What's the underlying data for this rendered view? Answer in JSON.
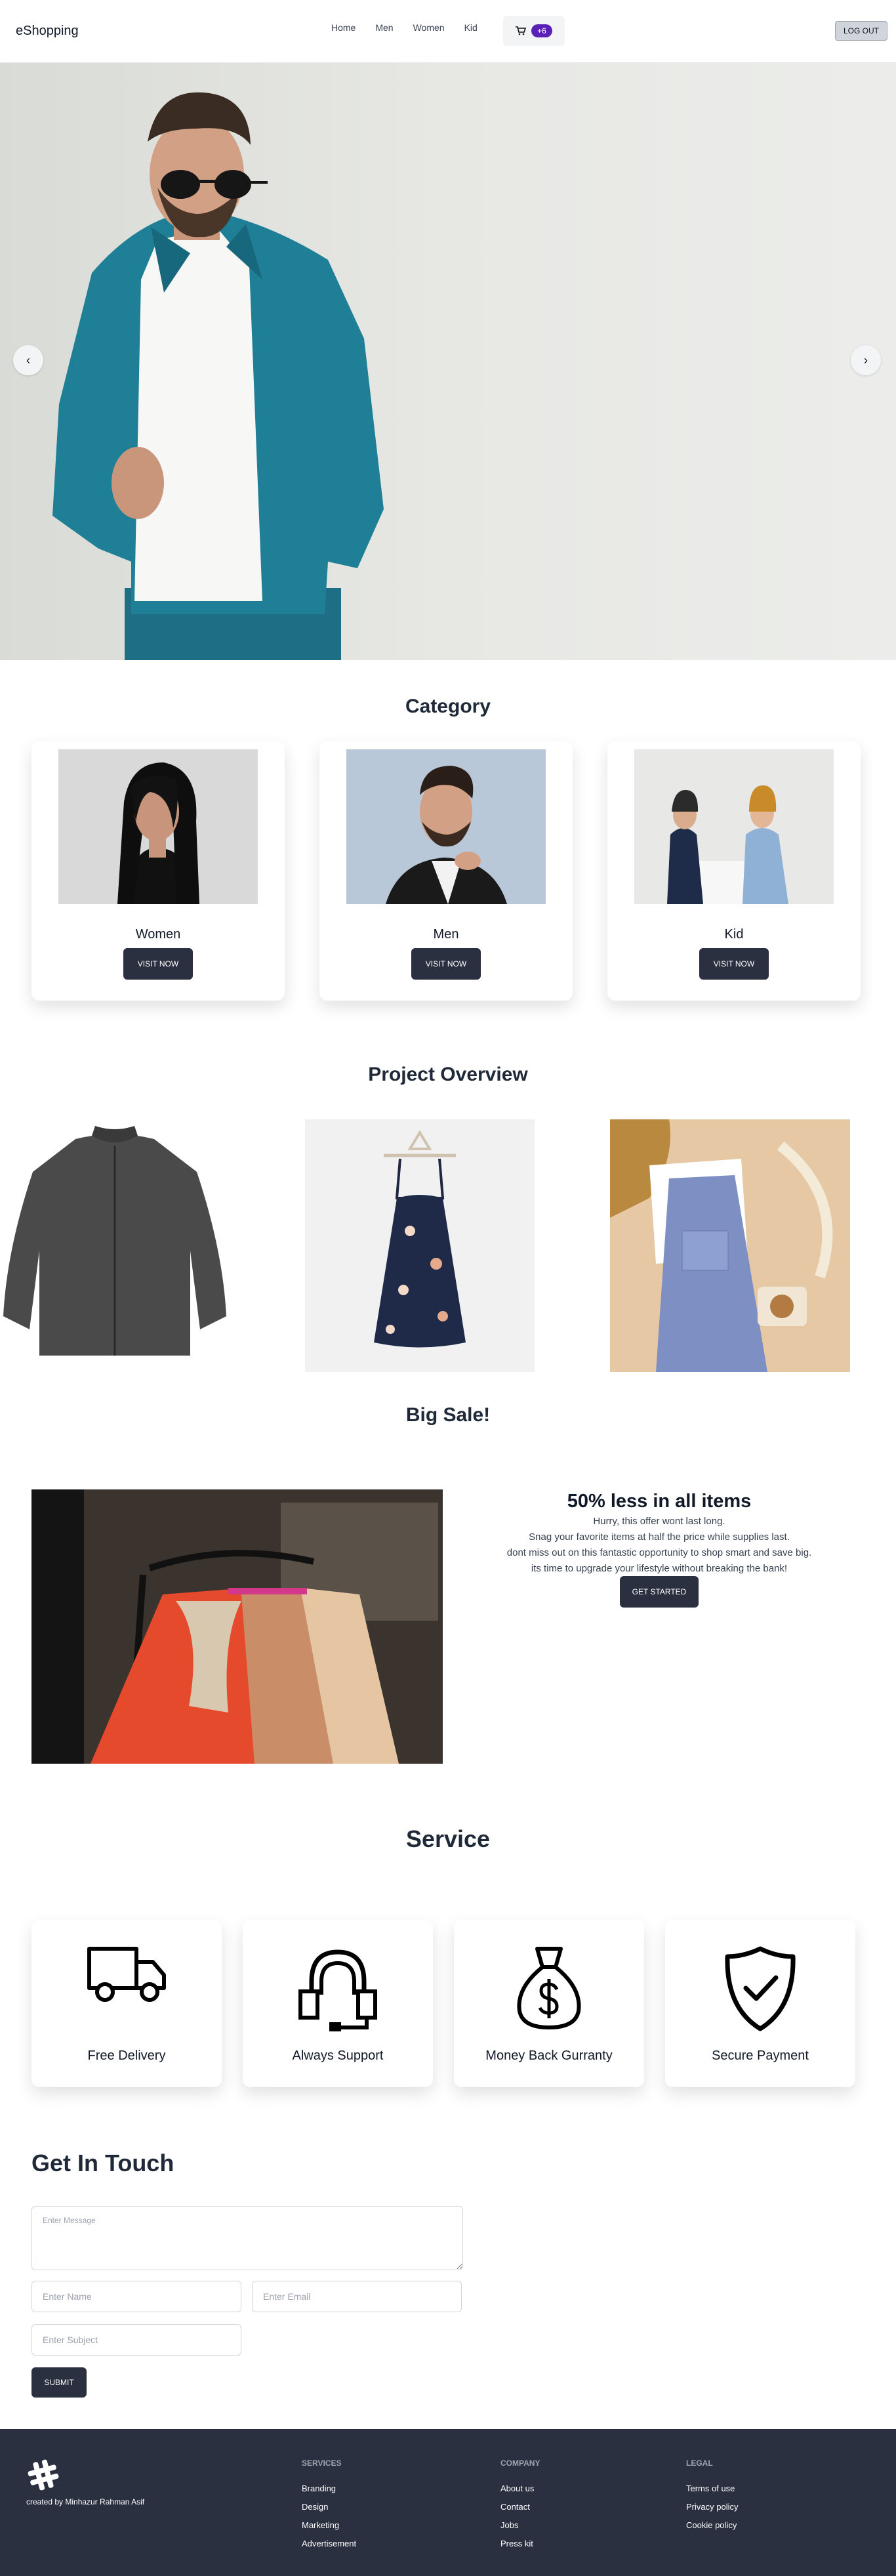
{
  "navbar": {
    "brand": "eShopping",
    "links": [
      "Home",
      "Men",
      "Women",
      "Kid"
    ],
    "cart_count": "+6",
    "logout_label": "LOG OUT"
  },
  "hero": {
    "prev": "‹",
    "next": "›"
  },
  "category": {
    "title": "Category",
    "cards": [
      {
        "name": "Women",
        "button": "VISIT NOW"
      },
      {
        "name": "Men",
        "button": "VISIT NOW"
      },
      {
        "name": "Kid",
        "button": "VISIT NOW"
      }
    ]
  },
  "overview": {
    "title": "Project Overview"
  },
  "sale": {
    "title": "Big Sale!",
    "heading": "50% less in all items",
    "lines": [
      "Hurry, this offer wont last long.",
      "Snag your favorite items at half the price while supplies last.",
      "dont miss out on this fantastic opportunity to shop smart and save big.",
      "its time to upgrade your lifestyle without breaking the bank!"
    ],
    "button": "GET STARTED"
  },
  "service": {
    "title": "Service",
    "items": [
      {
        "name": "Free Delivery",
        "icon": "truck-icon"
      },
      {
        "name": "Always Support",
        "icon": "headset-icon"
      },
      {
        "name": "Money Back Gurranty",
        "icon": "money-bag-icon"
      },
      {
        "name": "Secure Payment",
        "icon": "shield-check-icon"
      }
    ]
  },
  "contact": {
    "title": "Get In Touch",
    "message_placeholder": "Enter Message",
    "name_placeholder": "Enter Name",
    "email_placeholder": "Enter Email",
    "subject_placeholder": "Enter Subject",
    "submit": "SUBMIT"
  },
  "footer": {
    "credit": "created by Minhazur Rahman Asif",
    "columns": [
      {
        "heading": "SERVICES",
        "links": [
          "Branding",
          "Design",
          "Marketing",
          "Advertisement"
        ]
      },
      {
        "heading": "COMPANY",
        "links": [
          "About us",
          "Contact",
          "Jobs",
          "Press kit"
        ]
      },
      {
        "heading": "LEGAL",
        "links": [
          "Terms of use",
          "Privacy policy",
          "Cookie policy"
        ]
      }
    ]
  },
  "colors": {
    "dark": "#2b3040",
    "badge": "#5b21b6",
    "denim": "#1d7c93"
  }
}
